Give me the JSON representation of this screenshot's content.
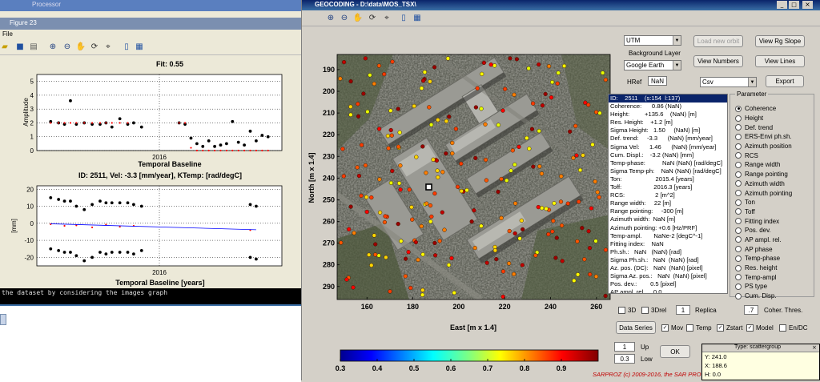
{
  "figure23": {
    "title": "Figure 23",
    "menu": "File",
    "top_chart_title": "Fit: 0.55",
    "top_ylabel": "Amplitude",
    "top_xlabel": "Temporal Baseline",
    "bottom_title": "ID: 2511, Vel: -3.3 [mm/year], KTemp:  [rad/degC]",
    "bottom_ylabel": "[mm]",
    "bottom_xlabel": "Temporal Baseline [years]",
    "console_text": "the dataset by considering the images graph",
    "behind_title": "Processor"
  },
  "geocoding": {
    "title": "GEOCODING - D:\\data\\MOS_TSX\\",
    "utm_select": "UTM",
    "load_button": "Load new orbit",
    "view_rg_slope": "View Rg Slope",
    "background_layer_label": "Background Layer",
    "background_select": "Google Earth",
    "view_numbers": "View Numbers",
    "view_lines": "View Lines",
    "href_label": "HRef",
    "href_value": "NaN",
    "format_select": "Csv",
    "export": "Export",
    "map_xlabel": "East [m x 1.4]",
    "map_ylabel": "North [m x 1.4]",
    "info_lines": [
      "ID:    2511    (s:154  l:137)",
      "Coherence:      0.86 (NaN)",
      "Height:         +135.6    (NaN) [m]",
      "Res. Height:    +1.2 [m]",
      "Sigma Height:   1.50     (NaN) [m]",
      "Def. trend:     -3.3      (NaN) [mm/year]",
      "Sigma Vel:      1.46      (NaN) [mm/year]",
      "Cum. Displ.:    -3.2 (NaN) [mm]",
      "Temp-phase:          NaN (NaN) [rad/degC]",
      "Sigma Temp-ph:    NaN (NaN) [rad/degC]",
      "Ton:                    2015.4 [years]",
      "Toff:                   2016.3 [years]",
      "RCS:                  2 [m^2]",
      "Range width:     22 [m]",
      "Range pointing:     -300 [m]",
      "Azimuth width:  NaN [m]",
      "Azimuth pointing: +0.6 [Hz/PRF]",
      "Temp-ampl.       NaNe-2 [degC^-1]",
      "Fitting index:    NaN",
      "Ph.sh.:   NaN   (NaN) [rad]",
      "Sigma Ph.sh.:   NaN  (NaN) [rad]",
      "Az. pos. (DC):   NaN  (NaN) [pixel]",
      "Sigma Az. pos.:   NaN  (NaN) [pixel]",
      "Pos. dev.:        0.5 [pixel]",
      "AP ampl. rel.     0.0"
    ],
    "parameter_title": "Parameter",
    "parameters": [
      "Coherence",
      "Height",
      "Def. trend",
      "ERS-Envi ph.sh.",
      "Azimuth position",
      "RCS",
      "Range width",
      "Range pointing",
      "Azimuth width",
      "Azimuth pointing",
      "Ton",
      "Toff",
      "Fitting index",
      "Pos. dev.",
      "AP ampl. rel.",
      "AP phase",
      "Temp-phase",
      "Res. height",
      "Temp-ampl",
      "PS type",
      "Cum. Disp."
    ],
    "selected_parameter": "Coherence",
    "cb_3d": "3D",
    "cb_3drel": "3Drel",
    "replica_value": "1",
    "replica_label": "Replica",
    "coher_value": ".7",
    "coher_label": "Coher. Thres.",
    "data_series": "Data Series",
    "cb_mov": "Mov",
    "cb_temp": "Temp",
    "cb_zstart": "Zstart",
    "cb_model": "Model",
    "cb_endc": "En/DC",
    "up_value": "1",
    "up_label": "Up",
    "low_value": "0.3",
    "low_label": "Low",
    "ok": "OK",
    "copyright": "SARPROZ (c) 2009-2016, the SAR PRO",
    "tooltip_title": "Type: scattergroup",
    "tooltip_y": "Y: 241.0",
    "tooltip_x": "X: 188.6",
    "tooltip_h": "H: 0.0"
  },
  "chart_data": [
    {
      "type": "scatter",
      "title": "Fit: 0.55",
      "xlabel": "Temporal Baseline",
      "ylabel": "Amplitude",
      "ylim": [
        0,
        5.5
      ],
      "yticks": [
        0,
        1,
        2,
        3,
        4,
        5
      ],
      "xtick_label": "2016",
      "series": [
        {
          "name": "",
          "color": "#000000",
          "x": [
            2015.45,
            2015.49,
            2015.52,
            2015.55,
            2015.58,
            2015.62,
            2015.66,
            2015.7,
            2015.73,
            2015.76,
            2015.8,
            2015.84,
            2015.87,
            2015.91,
            2016.1,
            2016.13,
            2016.16,
            2016.19,
            2016.22,
            2016.25,
            2016.28,
            2016.31,
            2016.34,
            2016.37,
            2016.4,
            2016.43,
            2016.46,
            2016.49,
            2016.52,
            2016.55
          ],
          "y": [
            2.1,
            2.0,
            1.9,
            3.6,
            1.9,
            2.0,
            1.9,
            1.9,
            2.0,
            1.7,
            2.3,
            1.9,
            2.0,
            1.7,
            2.0,
            1.9,
            0.9,
            0.5,
            0.3,
            0.7,
            0.3,
            0.4,
            0.5,
            2.1,
            0.6,
            0.4,
            1.4,
            0.7,
            1.1,
            1.0
          ]
        },
        {
          "name": "",
          "color": "#ff0000",
          "x": [
            2015.45,
            2015.49,
            2015.52,
            2015.55,
            2015.58,
            2015.62,
            2015.66,
            2015.7,
            2015.73,
            2015.76,
            2015.8,
            2015.84,
            2016.1,
            2016.13,
            2016.16,
            2016.19,
            2016.22,
            2016.25,
            2016.28,
            2016.31,
            2016.34,
            2016.37,
            2016.4,
            2016.43,
            2016.46,
            2016.49,
            2016.52,
            2016.55
          ],
          "y": [
            2.0,
            2.0,
            2.0,
            2.0,
            2.0,
            2.0,
            2.0,
            2.0,
            2.0,
            2.0,
            2.0,
            2.0,
            2.0,
            2.0,
            0.2,
            0.0,
            0.0,
            0.0,
            0.0,
            0.0,
            0.0,
            0.0,
            0.0,
            0.0,
            0.0,
            0.0,
            0.0,
            0.0
          ]
        }
      ]
    },
    {
      "type": "scatter",
      "title": "ID: 2511, Vel: -3.3 [mm/year], KTemp:  [rad/degC]",
      "xlabel": "Temporal Baseline [years]",
      "ylabel": "[mm]",
      "ylim": [
        -25,
        22
      ],
      "yticks": [
        -20,
        -10,
        0,
        10,
        20
      ],
      "xtick_label": "2016",
      "series": [
        {
          "name": "",
          "color": "#000000",
          "x": [
            2015.45,
            2015.49,
            2015.52,
            2015.55,
            2015.58,
            2015.62,
            2015.66,
            2015.7,
            2015.73,
            2015.76,
            2015.8,
            2015.84,
            2015.87,
            2015.91,
            2016.46,
            2016.49,
            2015.45,
            2015.49,
            2015.52,
            2015.55,
            2015.58,
            2015.62,
            2015.66,
            2015.7,
            2015.73,
            2015.76,
            2015.8,
            2015.84,
            2015.87,
            2015.91,
            2016.46,
            2016.49
          ],
          "y": [
            15,
            14,
            13,
            13,
            10,
            8,
            11,
            13,
            12,
            12,
            12,
            12,
            11,
            10,
            11,
            10,
            -15,
            -16,
            -17,
            -17,
            -19,
            -22,
            -20,
            -17,
            -18,
            -17,
            -17,
            -17,
            -18,
            -16,
            -20,
            -21
          ]
        },
        {
          "name": "",
          "color": "#ff0000",
          "x": [
            2015.45,
            2015.52,
            2015.58,
            2015.66,
            2015.73,
            2015.8,
            2015.87,
            2016.46
          ],
          "y": [
            -0.5,
            -1.5,
            -1.2,
            -2.4,
            -0.8,
            -2.0,
            -1.5,
            -4.0
          ]
        },
        {
          "name": "",
          "color": "#0000ff",
          "type": "line",
          "x": [
            2015.45,
            2016.49
          ],
          "y": [
            -0.3,
            -3.8
          ]
        }
      ]
    },
    {
      "type": "heatmap",
      "title": "",
      "xlabel": "East [m x 1.4]",
      "ylabel": "North [m x 1.4]",
      "xlim": [
        147,
        266
      ],
      "ylim": [
        296,
        183
      ],
      "xticks": [
        160,
        180,
        200,
        220,
        240,
        260
      ],
      "yticks": [
        190,
        200,
        210,
        220,
        230,
        240,
        250,
        260,
        270,
        280,
        290
      ],
      "colorbar": {
        "min": 0.3,
        "max": 1.0,
        "ticks": [
          0.3,
          0.4,
          0.5,
          0.6,
          0.7,
          0.8,
          0.9
        ]
      }
    }
  ]
}
